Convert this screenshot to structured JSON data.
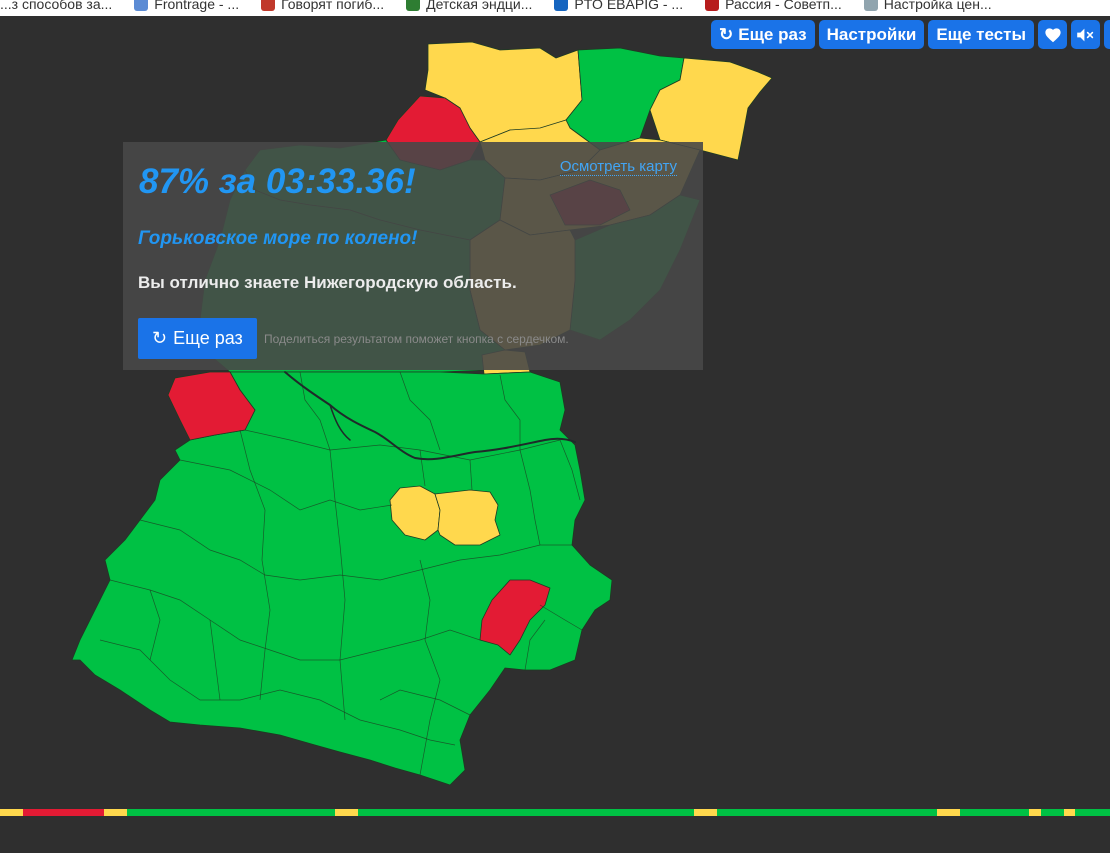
{
  "bookmarks": [
    {
      "label": "...з способов за...",
      "icon_color": "#888888"
    },
    {
      "label": "Frontrage - ...",
      "icon_color": "#5b8bd4"
    },
    {
      "label": "Говорят погиб...",
      "icon_color": "#c0392b"
    },
    {
      "label": "Детская эндци...",
      "icon_color": "#2e7d32"
    },
    {
      "label": "PTO EBAPIG - ...",
      "icon_color": "#1565c0"
    },
    {
      "label": "Рассия - Советп...",
      "icon_color": "#b71c1c"
    },
    {
      "label": "Настройка цен...",
      "icon_color": "#90a4ae"
    }
  ],
  "controls": {
    "retry_label": "Еще раз",
    "settings_label": "Настройки",
    "more_tests_label": "Еще тесты",
    "refresh_glyph": "↻",
    "heart_icon": "heart-icon",
    "mute_icon": "speaker-muted-icon",
    "close_icon": "close-icon"
  },
  "result": {
    "score_text": "87% за 03:33.36!",
    "view_map_link": "Осмотреть карту",
    "subtitle": "Горьковское море по колено!",
    "message": "Вы отлично знаете Нижегородскую область.",
    "retry_button_label": "Еще раз",
    "share_hint": "Поделиться результатом поможет кнопка с сердечком."
  },
  "map": {
    "name": "Нижегородская область",
    "status_colors": {
      "correct": "#00c144",
      "second_try": "#ffd84d",
      "wrong": "#e31b34"
    }
  },
  "progress": {
    "segments": [
      {
        "status": "second_try",
        "weight": 2
      },
      {
        "status": "wrong",
        "weight": 7
      },
      {
        "status": "second_try",
        "weight": 2
      },
      {
        "status": "correct",
        "weight": 18
      },
      {
        "status": "second_try",
        "weight": 2
      },
      {
        "status": "correct",
        "weight": 29
      },
      {
        "status": "second_try",
        "weight": 2
      },
      {
        "status": "correct",
        "weight": 19
      },
      {
        "status": "second_try",
        "weight": 2
      },
      {
        "status": "correct",
        "weight": 6
      },
      {
        "status": "second_try",
        "weight": 1
      },
      {
        "status": "correct",
        "weight": 2
      },
      {
        "status": "second_try",
        "weight": 1
      },
      {
        "status": "correct",
        "weight": 3
      }
    ]
  }
}
